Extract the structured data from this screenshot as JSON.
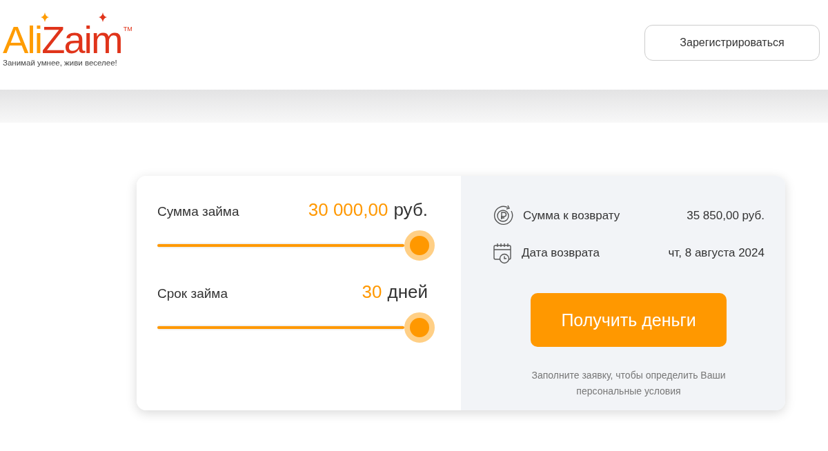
{
  "header": {
    "logo": {
      "part_1": "Ali",
      "part_2": "Zaim",
      "trademark": "TM",
      "tagline": "Занимай умнее, живи веселее!"
    },
    "register_button": "Зарегистрироваться"
  },
  "calculator": {
    "sliders": [
      {
        "label": "Сумма займа",
        "value": "30 000,00",
        "unit": "руб.",
        "level": 1
      },
      {
        "label": "Срок займа",
        "value": "30",
        "unit": "дней",
        "level": 1
      }
    ],
    "summary": [
      {
        "kind": "money",
        "label": "Сумма к возврату",
        "value": "35 850,00 руб."
      },
      {
        "kind": "calendar",
        "label": "Дата возврата",
        "value": "чт, 8 августа 2024"
      }
    ],
    "submit_button": "Получить деньги",
    "note": "Заполните заявку, чтобы определить Ваши персональные условия"
  }
}
